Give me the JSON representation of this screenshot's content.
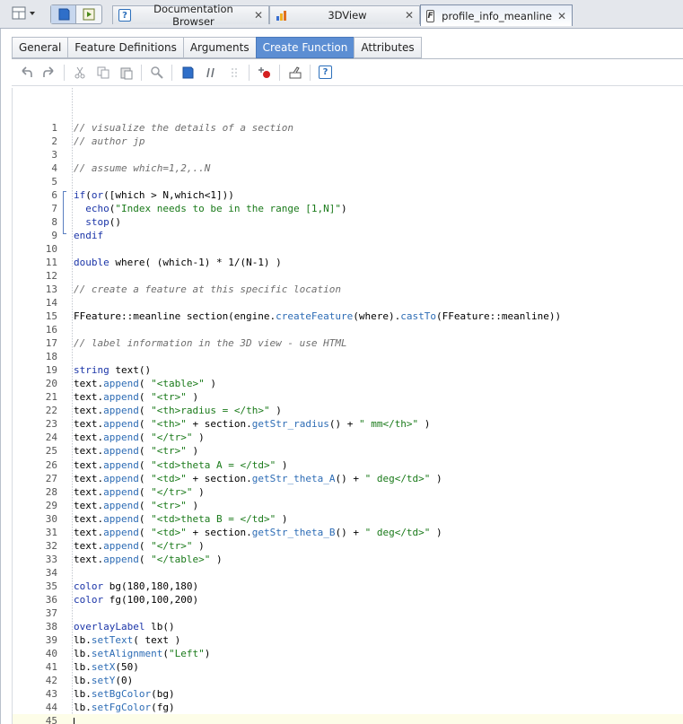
{
  "top_tabs": [
    {
      "label": "Documentation Browser",
      "icon": "help-icon",
      "active": false
    },
    {
      "label": "3DView",
      "icon": "bar-chart-icon",
      "active": false
    },
    {
      "label": "profile_info_meanline",
      "icon": "function-file-icon",
      "active": true
    }
  ],
  "sub_tabs": [
    {
      "label": "General",
      "active": false
    },
    {
      "label": "Feature Definitions",
      "active": false
    },
    {
      "label": "Arguments",
      "active": false
    },
    {
      "label": "Create Function",
      "active": true
    },
    {
      "label": "Attributes",
      "active": false
    }
  ],
  "toolbar_icons": [
    "undo-icon",
    "redo-icon",
    "cut-icon",
    "copy-icon",
    "paste-icon",
    "find-icon",
    "run-icon",
    "pause-icon",
    "step-icon",
    "add-breakpoint-icon",
    "clear-breakpoints-icon",
    "help-icon"
  ],
  "accent_color": "#5c8ed3",
  "code_lines": [
    "// visualize the details of a section",
    "// author jp",
    "",
    "// assume which=1,2,..N",
    "",
    "if(or([which > N,which<1]))",
    "  echo(\"Index needs to be in the range [1,N]\")",
    "  stop()",
    "endif",
    "",
    "double where( (which-1) * 1/(N-1) )",
    "",
    "// create a feature at this specific location",
    "",
    "FFeature::meanline section(engine.createFeature(where).castTo(FFeature::meanline))",
    "",
    "// label information in the 3D view - use HTML",
    "",
    "string text()",
    "text.append( \"<table>\" )",
    "text.append( \"<tr>\" )",
    "text.append( \"<th>radius = </th>\" )",
    "text.append( \"<th>\" + section.getStr_radius() + \" mm</th>\" )",
    "text.append( \"</tr>\" )",
    "text.append( \"<tr>\" )",
    "text.append( \"<td>theta A = </td>\" )",
    "text.append( \"<td>\" + section.getStr_theta_A() + \" deg</td>\" )",
    "text.append( \"</tr>\" )",
    "text.append( \"<tr>\" )",
    "text.append( \"<td>theta B = </td>\" )",
    "text.append( \"<td>\" + section.getStr_theta_B() + \" deg</td>\" )",
    "text.append( \"</tr>\" )",
    "text.append( \"</table>\" )",
    "",
    "color bg(180,180,180)",
    "color fg(100,100,200)",
    "",
    "overlayLabel lb()",
    "lb.setText( text )",
    "lb.setAlignment(\"Left\")",
    "lb.setX(50)",
    "lb.setY(0)",
    "lb.setBgColor(bg)",
    "lb.setFgColor(fg)",
    ""
  ]
}
